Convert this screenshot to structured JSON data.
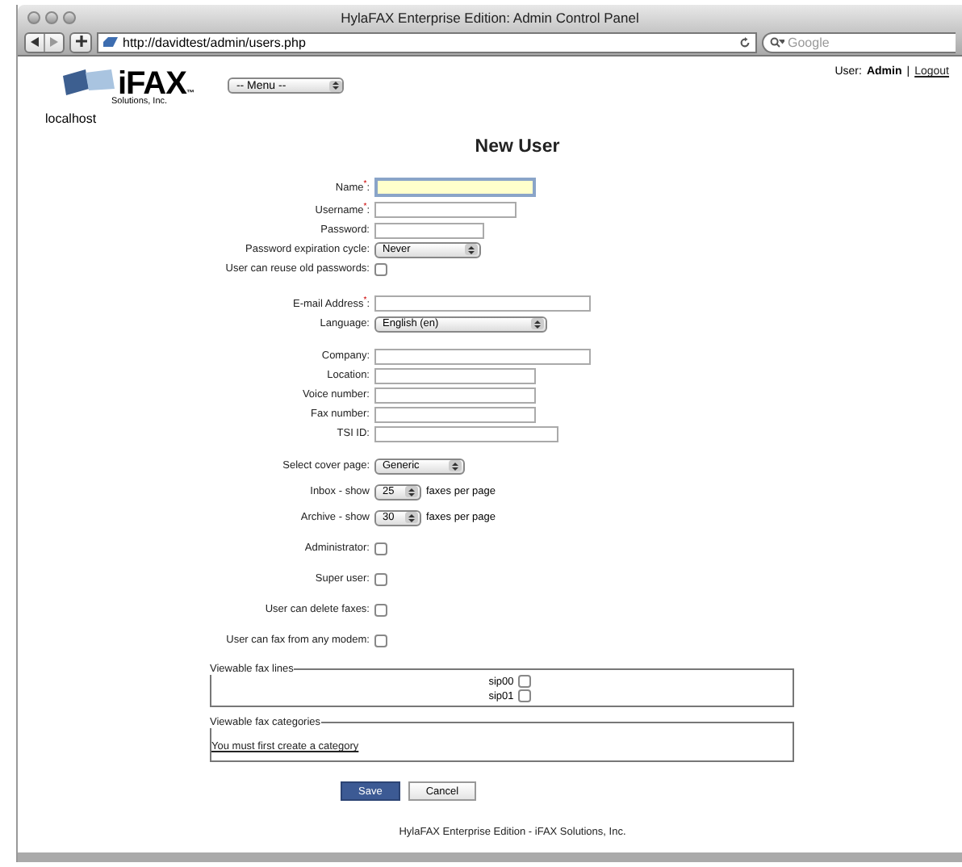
{
  "window": {
    "title": "HylaFAX Enterprise Edition: Admin Control Panel"
  },
  "toolbar": {
    "url": "http://davidtest/admin/users.php",
    "search": {
      "placeholder": "Google"
    }
  },
  "header": {
    "logo": {
      "name": "iFAX",
      "mark": "™",
      "tagline": "Solutions, Inc."
    },
    "menu": "-- Menu --",
    "host": "localhost",
    "user_label": "User:",
    "user": "Admin",
    "separator": "|",
    "logout": "Logout"
  },
  "heading": "New User",
  "sections": [
    [
      {
        "kind": "text",
        "label": "Name$^{*}$:",
        "focused": true
      },
      {
        "kind": "text",
        "label": "Username$^{*}$:",
        "focused": false
      },
      {
        "kind": "text",
        "label": "Password:",
        "focused": false
      },
      {
        "kind": "select",
        "label": "Password expiration cycle:",
        "value": "Never"
      },
      {
        "kind": "checkbox",
        "label": "User can reuse old passwords:",
        "checked": false
      }
    ],
    [
      {
        "kind": "text",
        "label": "E-mail Address$^{*}$:",
        "focused": false
      },
      {
        "kind": "select",
        "label": "Language:",
        "value": "English (en)"
      }
    ],
    [
      {
        "kind": "text",
        "label": "Company:",
        "focused": false
      },
      {
        "kind": "text",
        "label": "Location:",
        "focused": false
      },
      {
        "kind": "text",
        "label": "Voice number:",
        "focused": false
      },
      {
        "kind": "text",
        "label": "Fax number:",
        "focused": false
      },
      {
        "kind": "text",
        "label": "TSI ID:",
        "focused": false
      }
    ],
    [
      {
        "kind": "select",
        "label": "Select cover page:",
        "value": "Generic"
      },
      {
        "kind": "count",
        "label": "Inbox - show",
        "value": "25",
        "suffix": "faxes per page"
      },
      {
        "kind": "count",
        "label": "Archive - show",
        "value": "30",
        "suffix": "faxes per page"
      },
      {
        "kind": "checkbox",
        "label": "Administrator:",
        "checked": false
      },
      {
        "kind": "checkbox",
        "label": "Super user:",
        "checked": false
      },
      {
        "kind": "checkbox",
        "label": "User can delete faxes:",
        "checked": false
      },
      {
        "kind": "checkbox",
        "label": "User can fax from any modem:",
        "checked": false
      }
    ]
  ],
  "fax_lines": {
    "legend": "Viewable fax lines",
    "lines": [
      {
        "label": "sip00",
        "checked": false
      },
      {
        "label": "sip01",
        "checked": false
      }
    ]
  },
  "fax_categories": {
    "legend": "Viewable fax categories",
    "link": "You must first create a category"
  },
  "buttons": [
    "Save",
    "Cancel"
  ],
  "footer": "HylaFAX Enterprise Edition - iFAX Solutions, Inc."
}
